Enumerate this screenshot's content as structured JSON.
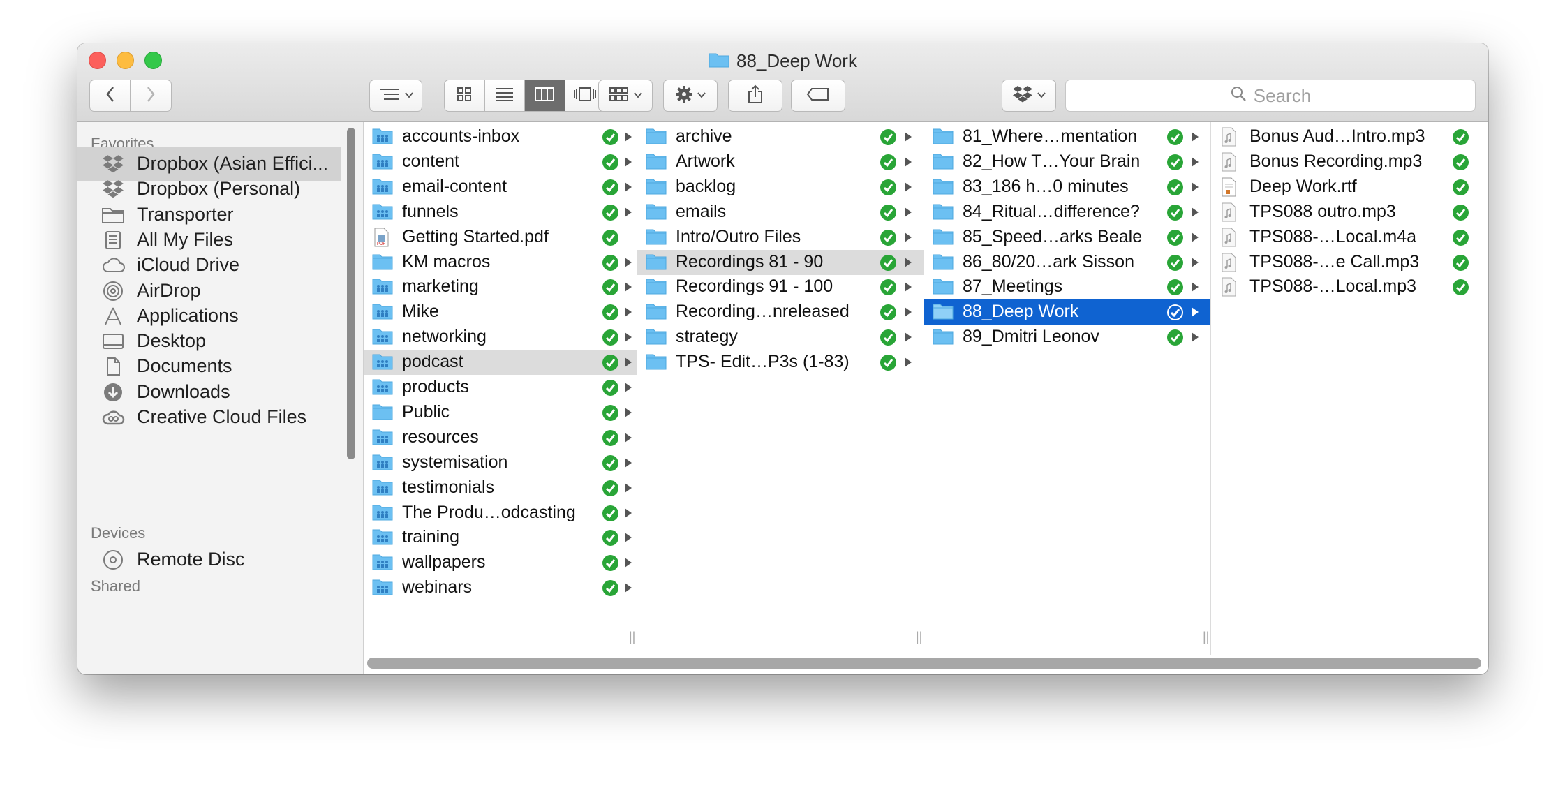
{
  "window": {
    "title": "88_Deep Work",
    "icons": {
      "title_folder": "folder-icon"
    }
  },
  "toolbar": {
    "back": "chevron-left-icon",
    "forward": "chevron-right-icon",
    "arrange": "arrange-list-icon",
    "views": [
      "icon-view-icon",
      "list-view-icon",
      "column-view-icon",
      "cover-flow-icon"
    ],
    "active_view": "column-view-icon",
    "group": "group-icon",
    "action": "gear-icon",
    "share": "share-icon",
    "tag": "tag-icon",
    "dropbox": "dropbox-icon"
  },
  "search": {
    "placeholder": "Search"
  },
  "sidebar": {
    "favorites_heading": "Favorites",
    "favorites": [
      {
        "label": "Dropbox (Asian Effici...",
        "icon": "dropbox-icon",
        "selected": true
      },
      {
        "label": "Dropbox (Personal)",
        "icon": "dropbox-icon"
      },
      {
        "label": "Transporter",
        "icon": "folder-icon"
      },
      {
        "label": "All My Files",
        "icon": "all-files-icon"
      },
      {
        "label": "iCloud Drive",
        "icon": "cloud-icon"
      },
      {
        "label": "AirDrop",
        "icon": "airdrop-icon"
      },
      {
        "label": "Applications",
        "icon": "applications-icon"
      },
      {
        "label": "Desktop",
        "icon": "desktop-icon"
      },
      {
        "label": "Documents",
        "icon": "documents-icon"
      },
      {
        "label": "Downloads",
        "icon": "downloads-icon"
      },
      {
        "label": "Creative Cloud Files",
        "icon": "creative-cloud-icon"
      }
    ],
    "devices_heading": "Devices",
    "devices": [
      {
        "label": "Remote Disc",
        "icon": "disc-icon"
      }
    ],
    "shared_heading": "Shared"
  },
  "columns": [
    {
      "items": [
        {
          "label": "accounts-inbox",
          "icon": "shared-folder-icon",
          "synced": true,
          "folder": true
        },
        {
          "label": "content",
          "icon": "shared-folder-icon",
          "synced": true,
          "folder": true
        },
        {
          "label": "email-content",
          "icon": "shared-folder-icon",
          "synced": true,
          "folder": true
        },
        {
          "label": "funnels",
          "icon": "shared-folder-icon",
          "synced": true,
          "folder": true
        },
        {
          "label": "Getting Started.pdf",
          "icon": "pdf-file-icon",
          "synced": true,
          "folder": false
        },
        {
          "label": "KM macros",
          "icon": "folder-icon",
          "synced": true,
          "folder": true
        },
        {
          "label": "marketing",
          "icon": "shared-folder-icon",
          "synced": true,
          "folder": true
        },
        {
          "label": "Mike",
          "icon": "shared-folder-icon",
          "synced": true,
          "folder": true
        },
        {
          "label": "networking",
          "icon": "shared-folder-icon",
          "synced": true,
          "folder": true
        },
        {
          "label": "podcast",
          "icon": "shared-folder-icon",
          "synced": true,
          "folder": true,
          "state": "highlighted"
        },
        {
          "label": "products",
          "icon": "shared-folder-icon",
          "synced": true,
          "folder": true
        },
        {
          "label": "Public",
          "icon": "folder-icon",
          "synced": true,
          "folder": true
        },
        {
          "label": "resources",
          "icon": "shared-folder-icon",
          "synced": true,
          "folder": true
        },
        {
          "label": "systemisation",
          "icon": "shared-folder-icon",
          "synced": true,
          "folder": true
        },
        {
          "label": "testimonials",
          "icon": "shared-folder-icon",
          "synced": true,
          "folder": true
        },
        {
          "label": "The Produ…odcasting",
          "icon": "shared-folder-icon",
          "synced": true,
          "folder": true
        },
        {
          "label": "training",
          "icon": "shared-folder-icon",
          "synced": true,
          "folder": true
        },
        {
          "label": "wallpapers",
          "icon": "shared-folder-icon",
          "synced": true,
          "folder": true
        },
        {
          "label": "webinars",
          "icon": "shared-folder-icon",
          "synced": true,
          "folder": true
        }
      ]
    },
    {
      "items": [
        {
          "label": "archive",
          "icon": "folder-icon",
          "synced": true,
          "folder": true
        },
        {
          "label": "Artwork",
          "icon": "folder-icon",
          "synced": true,
          "folder": true
        },
        {
          "label": "backlog",
          "icon": "folder-icon",
          "synced": true,
          "folder": true
        },
        {
          "label": "emails",
          "icon": "folder-icon",
          "synced": true,
          "folder": true
        },
        {
          "label": "Intro/Outro Files",
          "icon": "folder-icon",
          "synced": true,
          "folder": true
        },
        {
          "label": "Recordings 81 - 90",
          "icon": "folder-icon",
          "synced": true,
          "folder": true,
          "state": "highlighted"
        },
        {
          "label": "Recordings 91 - 100",
          "icon": "folder-icon",
          "synced": true,
          "folder": true
        },
        {
          "label": "Recording…nreleased",
          "icon": "folder-icon",
          "synced": true,
          "folder": true
        },
        {
          "label": "strategy",
          "icon": "folder-icon",
          "synced": true,
          "folder": true
        },
        {
          "label": "TPS- Edit…P3s (1-83)",
          "icon": "folder-icon",
          "synced": true,
          "folder": true
        }
      ]
    },
    {
      "items": [
        {
          "label": "81_Where…mentation",
          "icon": "folder-icon",
          "synced": true,
          "folder": true
        },
        {
          "label": "82_How T…Your Brain",
          "icon": "folder-icon",
          "synced": true,
          "folder": true
        },
        {
          "label": "83_186 h…0 minutes",
          "icon": "folder-icon",
          "synced": true,
          "folder": true
        },
        {
          "label": "84_Ritual…difference?",
          "icon": "folder-icon",
          "synced": true,
          "folder": true
        },
        {
          "label": "85_Speed…arks Beale",
          "icon": "folder-icon",
          "synced": true,
          "folder": true
        },
        {
          "label": "86_80/20…ark Sisson",
          "icon": "folder-icon",
          "synced": true,
          "folder": true
        },
        {
          "label": "87_Meetings",
          "icon": "folder-icon",
          "synced": true,
          "folder": true
        },
        {
          "label": "88_Deep Work",
          "icon": "folder-icon",
          "synced": true,
          "folder": true,
          "state": "selected"
        },
        {
          "label": "89_Dmitri Leonov",
          "icon": "folder-icon",
          "synced": true,
          "folder": true
        }
      ]
    },
    {
      "items": [
        {
          "label": "Bonus Aud…Intro.mp3",
          "icon": "audio-file-icon",
          "synced": true,
          "folder": false
        },
        {
          "label": "Bonus Recording.mp3",
          "icon": "audio-file-icon",
          "synced": true,
          "folder": false
        },
        {
          "label": "Deep Work.rtf",
          "icon": "rtf-file-icon",
          "synced": true,
          "folder": false
        },
        {
          "label": "TPS088 outro.mp3",
          "icon": "audio-file-icon",
          "synced": true,
          "folder": false
        },
        {
          "label": "TPS088-…Local.m4a",
          "icon": "audio-file-icon",
          "synced": true,
          "folder": false
        },
        {
          "label": "TPS088-…e Call.mp3",
          "icon": "audio-file-icon",
          "synced": true,
          "folder": false
        },
        {
          "label": "TPS088-…Local.mp3",
          "icon": "audio-file-icon",
          "synced": true,
          "folder": false
        }
      ]
    }
  ],
  "colors": {
    "selection": "#0f63d1",
    "highlight": "#dcdcdc",
    "sync_check": "#29a537",
    "folder_blue": "#6cc0f2"
  }
}
